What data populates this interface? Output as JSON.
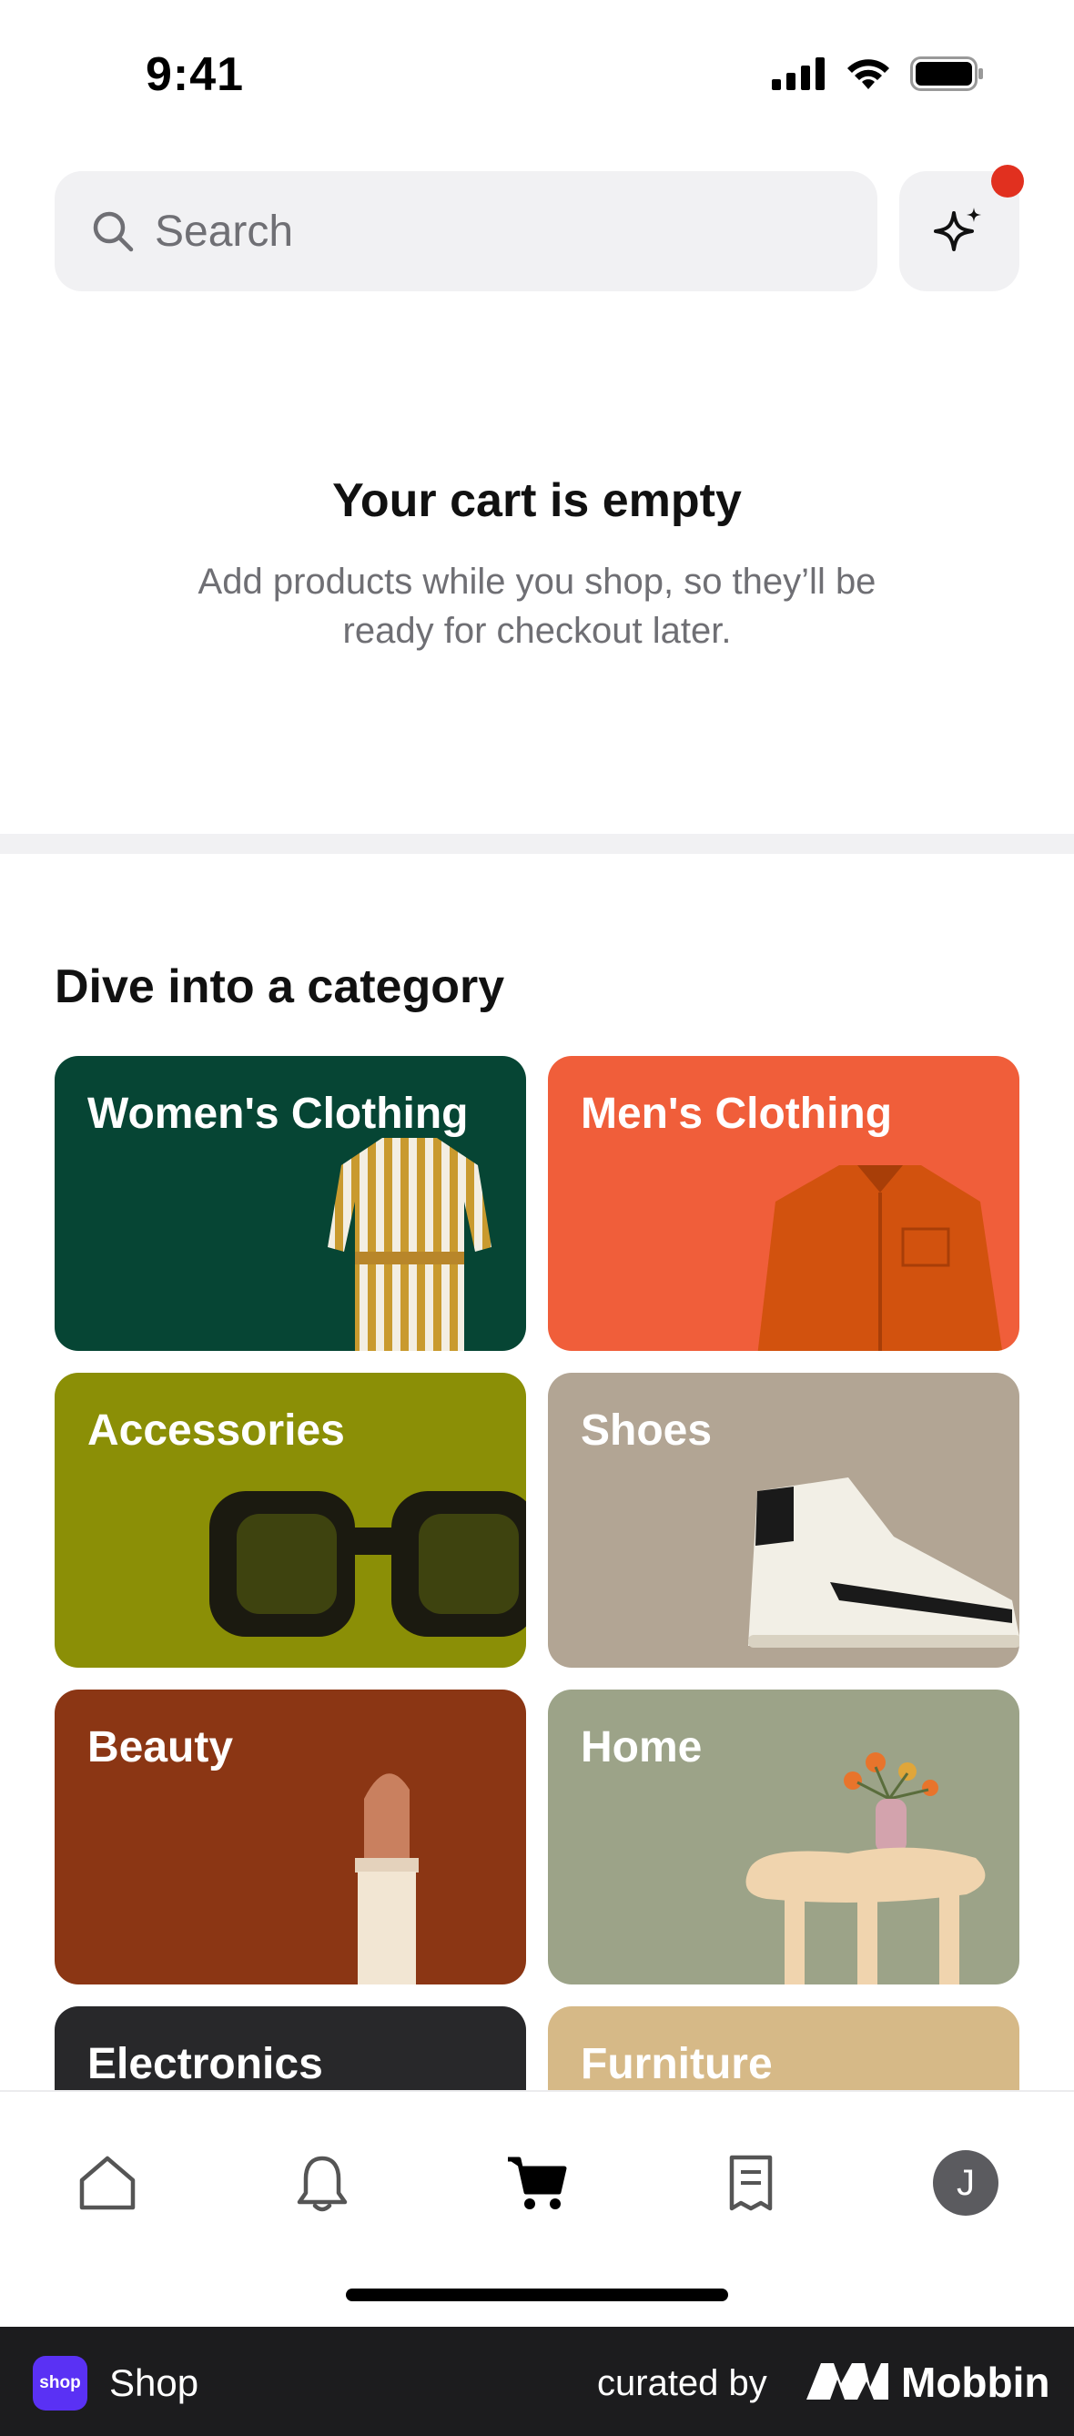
{
  "status_bar": {
    "time": "9:41",
    "icons": [
      "cellular-signal-icon",
      "wifi-icon",
      "battery-icon"
    ]
  },
  "search": {
    "placeholder": "Search",
    "ai_icon": "sparkles-icon",
    "has_notification": true
  },
  "empty_cart": {
    "title": "Your cart is empty",
    "subtitle": "Add products while you shop, so they’ll be ready for checkout later."
  },
  "categories": {
    "heading": "Dive into a category",
    "items": [
      {
        "label": "Women's Clothing",
        "color": "#064534"
      },
      {
        "label": "Men's Clothing",
        "color": "#f05e3a"
      },
      {
        "label": "Accessories",
        "color": "#8b8f06"
      },
      {
        "label": "Shoes",
        "color": "#b2a594"
      },
      {
        "label": "Beauty",
        "color": "#8b3614"
      },
      {
        "label": "Home",
        "color": "#9ca388"
      },
      {
        "label": "Electronics",
        "color": "#28282a"
      },
      {
        "label": "Furniture",
        "color": "#d6b987"
      }
    ]
  },
  "tab_bar": {
    "tabs": [
      {
        "icon": "home-icon",
        "active": false
      },
      {
        "icon": "bell-icon",
        "active": false
      },
      {
        "icon": "cart-icon",
        "active": true
      },
      {
        "icon": "receipt-icon",
        "active": false
      },
      {
        "icon": "profile-avatar",
        "initial": "J",
        "active": false
      }
    ]
  },
  "footer": {
    "app_name": "Shop",
    "app_logo_text": "shop",
    "curated_by": "curated by",
    "brand": "Mobbin"
  }
}
